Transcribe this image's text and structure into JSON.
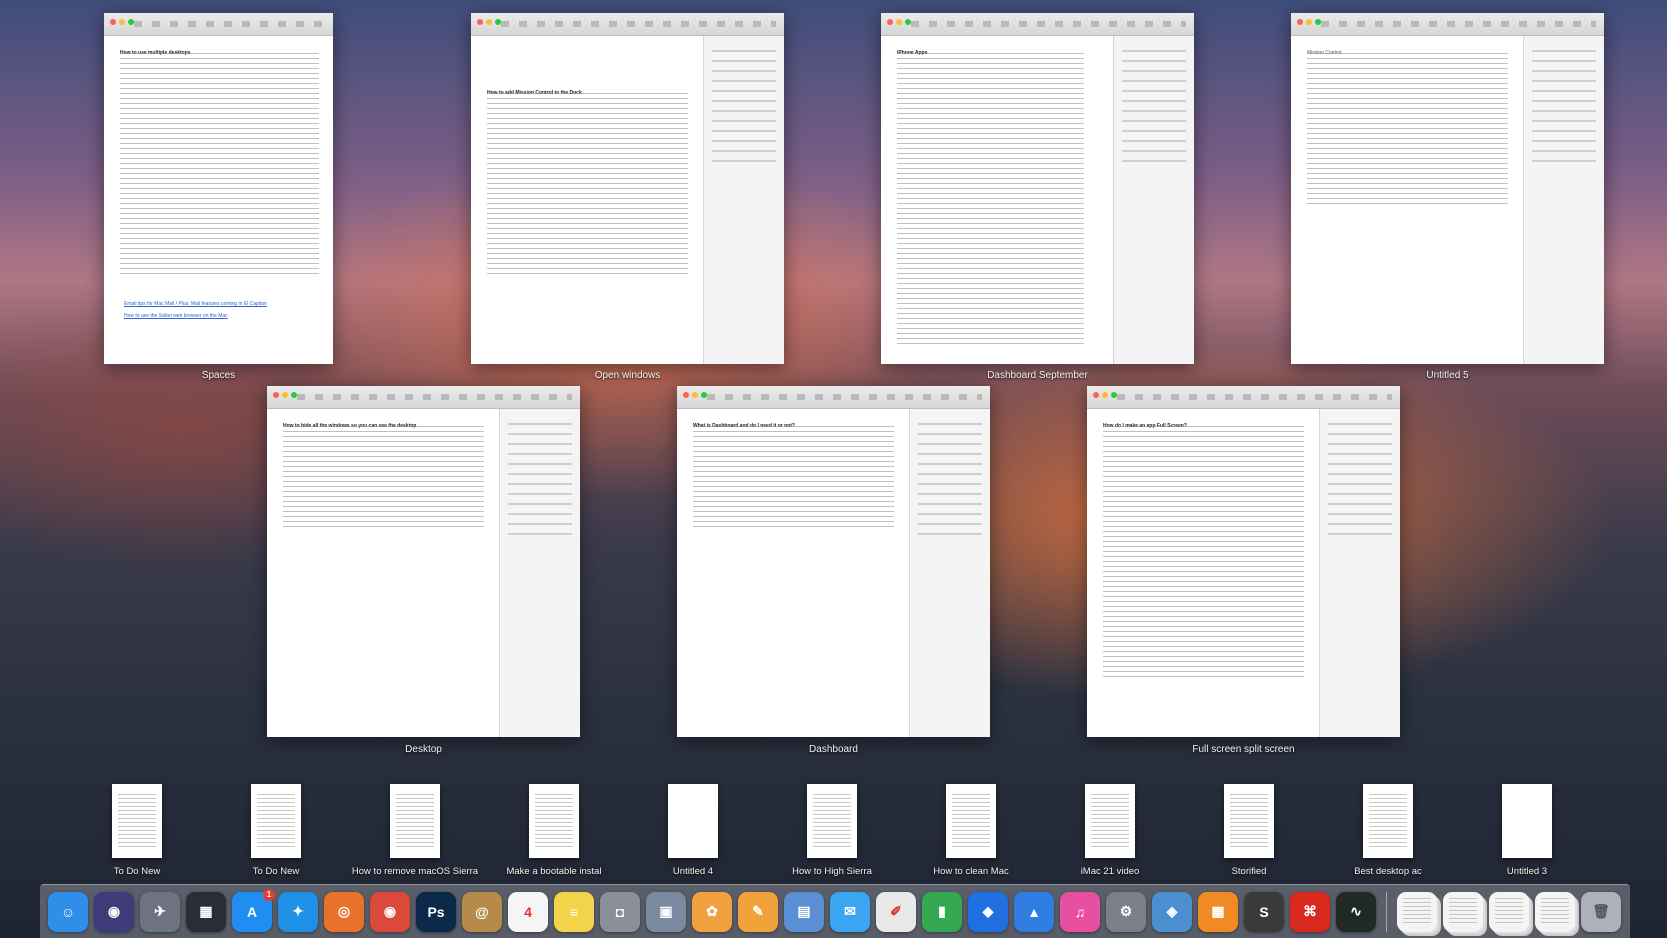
{
  "mission_control": {
    "windows": [
      {
        "label": "Spaces",
        "doc_title": "How to use multiple desktops",
        "links": [
          "Email tips for Mac Mail / Plus: Mail features coming in El Capitan",
          "How to use the Safari web browser on the Mac"
        ]
      },
      {
        "label": "Open windows",
        "doc_title": "How to add Mission Control to the Dock"
      },
      {
        "label": "Dashboard September",
        "doc_title": "iPhone Apps"
      },
      {
        "label": "Untitled 5",
        "doc_title": "Mission Control"
      },
      {
        "label": "Desktop",
        "doc_title": "How to hide all the windows so you can see the desktop"
      },
      {
        "label": "Dashboard",
        "doc_title": "What is Dashboard and do I need it or not?"
      },
      {
        "label": "Full screen split screen",
        "doc_title": "How do I make an app Full Screen?"
      }
    ],
    "minimized_documents": [
      {
        "label": "To Do New"
      },
      {
        "label": "To Do New"
      },
      {
        "label": "How to remove macOS Sierra"
      },
      {
        "label": "Make a bootable instal"
      },
      {
        "label": "Untitled 4"
      },
      {
        "label": "How to High Sierra"
      },
      {
        "label": "How to clean Mac"
      },
      {
        "label": "iMac 21 video"
      },
      {
        "label": "Storified"
      },
      {
        "label": "Best desktop ac"
      },
      {
        "label": "Untitled 3"
      }
    ]
  },
  "dock": {
    "apps": [
      {
        "name": "finder-icon",
        "glyph": "☺",
        "color": "#2f8ee8"
      },
      {
        "name": "siri-icon",
        "glyph": "◉",
        "color": "#3d3b7a"
      },
      {
        "name": "launchpad-icon",
        "glyph": "✈",
        "color": "#6e7380"
      },
      {
        "name": "mission-control-icon",
        "glyph": "▦",
        "color": "#2a2d36"
      },
      {
        "name": "app-store-icon",
        "glyph": "A",
        "color": "#1f8ef0",
        "badge": "1"
      },
      {
        "name": "safari-icon",
        "glyph": "✦",
        "color": "#1e90e6"
      },
      {
        "name": "firefox-icon",
        "glyph": "◎",
        "color": "#e8712c"
      },
      {
        "name": "chrome-icon",
        "glyph": "◉",
        "color": "#d94a3a"
      },
      {
        "name": "photoshop-icon",
        "glyph": "Ps",
        "color": "#0b2a4a"
      },
      {
        "name": "contacts-icon",
        "glyph": "@",
        "color": "#b58a4a"
      },
      {
        "name": "calendar-icon",
        "glyph": "4",
        "color": "#f5f5f5"
      },
      {
        "name": "notes-icon",
        "glyph": "≡",
        "color": "#f3d34a"
      },
      {
        "name": "image-capture-icon",
        "glyph": "◘",
        "color": "#8a8f99"
      },
      {
        "name": "preview-icon",
        "glyph": "▣",
        "color": "#7a8aa0"
      },
      {
        "name": "photos-icon",
        "glyph": "✿",
        "color": "#f0a040"
      },
      {
        "name": "pages-icon",
        "glyph": "✎",
        "color": "#f2a23a"
      },
      {
        "name": "preview-docs-icon",
        "glyph": "▤",
        "color": "#5b8fd4"
      },
      {
        "name": "messages-icon",
        "glyph": "✉",
        "color": "#3aa5f0"
      },
      {
        "name": "textedit-icon",
        "glyph": "✐",
        "color": "#e8e8e8"
      },
      {
        "name": "numbers-icon",
        "glyph": "▮",
        "color": "#35a852"
      },
      {
        "name": "dropbox-icon",
        "glyph": "◆",
        "color": "#1f6fe0"
      },
      {
        "name": "keynote-icon",
        "glyph": "▲",
        "color": "#2f7de0"
      },
      {
        "name": "itunes-icon",
        "glyph": "♫",
        "color": "#e94fa0"
      },
      {
        "name": "system-preferences-icon",
        "glyph": "⚙",
        "color": "#7b7f88"
      },
      {
        "name": "preview-map-icon",
        "glyph": "◈",
        "color": "#4b8fd0"
      },
      {
        "name": "ibooks-icon",
        "glyph": "▦",
        "color": "#f08a24"
      },
      {
        "name": "scrivener-icon",
        "glyph": "S",
        "color": "#3a3a3a"
      },
      {
        "name": "acrobat-icon",
        "glyph": "⌘",
        "color": "#d9281e"
      },
      {
        "name": "activity-monitor-icon",
        "glyph": "∿",
        "color": "#1f2a24"
      }
    ],
    "stacks": [
      {
        "name": "document-stack-1-icon"
      },
      {
        "name": "document-stack-2-icon"
      },
      {
        "name": "screenshot-stack-icon"
      },
      {
        "name": "document-stack-3-icon"
      },
      {
        "name": "trash-icon",
        "glyph": "🗑"
      }
    ]
  }
}
